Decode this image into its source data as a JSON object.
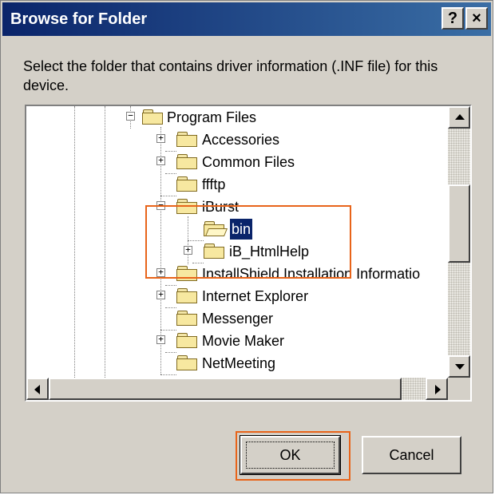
{
  "window": {
    "title": "Browse for Folder",
    "help_label": "?",
    "close_label": "×"
  },
  "instruction": "Select the folder that contains driver information (.INF file) for this device.",
  "tree": {
    "items": [
      {
        "label": "Program Files",
        "expander": "−",
        "selected": false
      },
      {
        "label": "Accessories",
        "expander": "+",
        "selected": false
      },
      {
        "label": "Common Files",
        "expander": "+",
        "selected": false
      },
      {
        "label": "ffftp",
        "expander": "",
        "selected": false
      },
      {
        "label": "iBurst",
        "expander": "−",
        "selected": false
      },
      {
        "label": "bin",
        "expander": "",
        "selected": true
      },
      {
        "label": "iB_HtmlHelp",
        "expander": "+",
        "selected": false
      },
      {
        "label": "InstallShield Installation Informatio",
        "expander": "+",
        "selected": false
      },
      {
        "label": "Internet Explorer",
        "expander": "+",
        "selected": false
      },
      {
        "label": "Messenger",
        "expander": "",
        "selected": false
      },
      {
        "label": "Movie Maker",
        "expander": "+",
        "selected": false
      },
      {
        "label": "NetMeeting",
        "expander": "",
        "selected": false
      }
    ]
  },
  "buttons": {
    "ok": "OK",
    "cancel": "Cancel"
  },
  "colors": {
    "highlight_border": "#e8641a",
    "selection": "#0a246a",
    "title_bar": "#0a246a"
  }
}
